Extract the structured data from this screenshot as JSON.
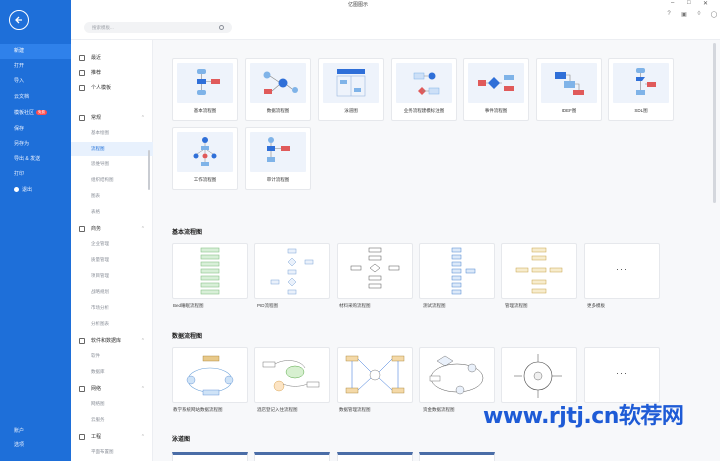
{
  "window": {
    "title": "亿图图示"
  },
  "top": {
    "search_placeholder": "搜索模板..."
  },
  "leftnav": {
    "items": [
      "新建",
      "打开",
      "导入",
      "云文档",
      "模板社区",
      "保存",
      "另存为",
      "导出 & 发送",
      "打印",
      "退出",
      "账户",
      "选项"
    ],
    "badge": "免费",
    "active": "新建"
  },
  "categories": {
    "top": [
      "最近",
      "推荐",
      "个人模板"
    ],
    "group1": {
      "label": "常规",
      "subs": [
        "基本绘图",
        "流程图",
        "思维导图",
        "组织结构图",
        "图表",
        "表格"
      ]
    },
    "group2": {
      "label": "商务",
      "subs": [
        "企业管理",
        "质量管理",
        "项目管理",
        "战略规划",
        "市场分析",
        "分析图表"
      ]
    },
    "group3": {
      "label": "软件和数据库",
      "subs": [
        "软件",
        "数据库"
      ]
    },
    "group4": {
      "label": "网络",
      "subs": [
        "网络图",
        "云服务"
      ]
    },
    "group5": {
      "label": "工程",
      "subs": [
        "平面布置图"
      ]
    }
  },
  "templates": {
    "row1": [
      "基本流程图",
      "数据流程图",
      "泳道图",
      "业务流程建模标注图",
      "事件流程图",
      "IDEF图",
      "SDL图"
    ],
    "row2": [
      "工作流程图",
      "审计流程图"
    ]
  },
  "sections": [
    {
      "title": "基本流程图",
      "examples": [
        "Bed睡眠流程图",
        "PID流程图",
        "材料采购流程图",
        "测试流程图",
        "管理流程图",
        "更多模板"
      ]
    },
    {
      "title": "数据流程图",
      "examples": [
        "教学系统网站数据流程图",
        "酒店登记入住流程图",
        "数据管理流程图",
        "资金数据流程图",
        "",
        ""
      ]
    },
    {
      "title": "泳道图",
      "examples": []
    }
  ],
  "more_dots": "···",
  "watermark": "www.rjtj.cn软荐网",
  "colors": {
    "nav_blue": "#1e6fd9",
    "accent_red": "#e05a5a",
    "accent_blue": "#2f6fd8"
  }
}
